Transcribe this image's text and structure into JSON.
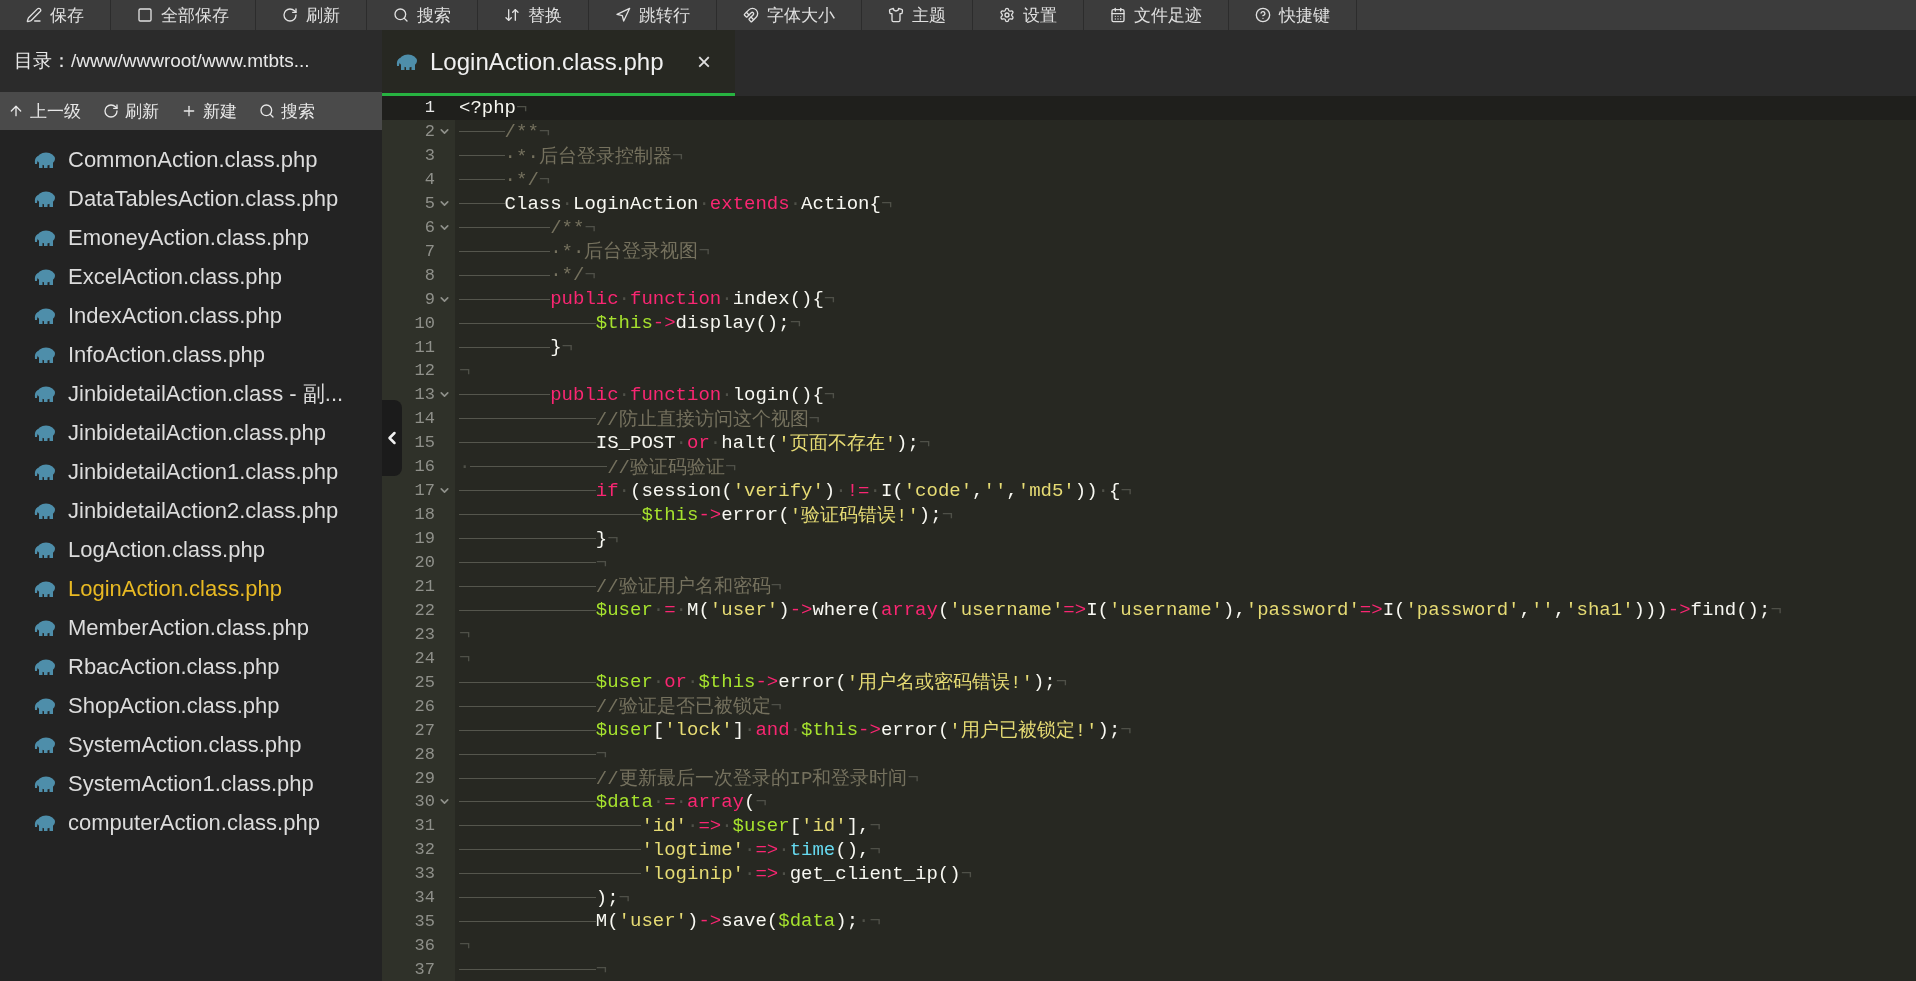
{
  "toolbar": [
    {
      "label": "保存"
    },
    {
      "label": "全部保存"
    },
    {
      "label": "刷新"
    },
    {
      "label": "搜索"
    },
    {
      "label": "替换"
    },
    {
      "label": "跳转行"
    },
    {
      "label": "字体大小"
    },
    {
      "label": "主题"
    },
    {
      "label": "设置"
    },
    {
      "label": "文件足迹"
    },
    {
      "label": "快捷键"
    }
  ],
  "sidebar": {
    "directory": "目录：/www/wwwroot/www.mtbts...",
    "actions": [
      {
        "label": "上一级"
      },
      {
        "label": "刷新"
      },
      {
        "label": "新建"
      },
      {
        "label": "搜索"
      }
    ],
    "files": [
      {
        "name": "CommonAction.class.php",
        "selected": false
      },
      {
        "name": "DataTablesAction.class.php",
        "selected": false
      },
      {
        "name": "EmoneyAction.class.php",
        "selected": false
      },
      {
        "name": "ExcelAction.class.php",
        "selected": false
      },
      {
        "name": "IndexAction.class.php",
        "selected": false
      },
      {
        "name": "InfoAction.class.php",
        "selected": false
      },
      {
        "name": "JinbidetailAction.class - 副...",
        "selected": false
      },
      {
        "name": "JinbidetailAction.class.php",
        "selected": false
      },
      {
        "name": "JinbidetailAction1.class.php",
        "selected": false
      },
      {
        "name": "JinbidetailAction2.class.php",
        "selected": false
      },
      {
        "name": "LogAction.class.php",
        "selected": false
      },
      {
        "name": "LoginAction.class.php",
        "selected": true
      },
      {
        "name": "MemberAction.class.php",
        "selected": false
      },
      {
        "name": "RbacAction.class.php",
        "selected": false
      },
      {
        "name": "ShopAction.class.php",
        "selected": false
      },
      {
        "name": "SystemAction.class.php",
        "selected": false
      },
      {
        "name": "SystemAction1.class.php",
        "selected": false
      },
      {
        "name": "computerAction.class.php",
        "selected": false
      }
    ]
  },
  "tabs": [
    {
      "label": "LoginAction.class.php",
      "close": "×",
      "selected": true
    }
  ],
  "code_lines": [
    {
      "number": "1",
      "active": true,
      "fold": false,
      "tokens": [
        {
          "kind": "pl",
          "text": "<?php"
        },
        {
          "kind": "ws",
          "text": "¬"
        }
      ]
    },
    {
      "number": "2",
      "active": false,
      "fold": true,
      "tokens": [
        {
          "kind": "tab"
        },
        {
          "kind": "cm",
          "text": "/**"
        },
        {
          "kind": "ws",
          "text": "¬"
        }
      ]
    },
    {
      "number": "3",
      "active": false,
      "fold": false,
      "tokens": [
        {
          "kind": "tab"
        },
        {
          "kind": "cm",
          "text": "·*·后台登录控制器"
        },
        {
          "kind": "ws",
          "text": "¬"
        }
      ]
    },
    {
      "number": "4",
      "active": false,
      "fold": false,
      "tokens": [
        {
          "kind": "tab"
        },
        {
          "kind": "cm",
          "text": "·*/"
        },
        {
          "kind": "ws",
          "text": "¬"
        }
      ]
    },
    {
      "number": "5",
      "active": false,
      "fold": true,
      "tokens": [
        {
          "kind": "tab"
        },
        {
          "kind": "pl",
          "text": "Class"
        },
        {
          "kind": "ws",
          "text": "·"
        },
        {
          "kind": "pl",
          "text": "LoginAction"
        },
        {
          "kind": "ws",
          "text": "·"
        },
        {
          "kind": "kw",
          "text": "extends"
        },
        {
          "kind": "ws",
          "text": "·"
        },
        {
          "kind": "pl",
          "text": "Action{"
        },
        {
          "kind": "ws",
          "text": "¬"
        }
      ]
    },
    {
      "number": "6",
      "active": false,
      "fold": true,
      "tokens": [
        {
          "kind": "tab"
        },
        {
          "kind": "tab"
        },
        {
          "kind": "cm",
          "text": "/**"
        },
        {
          "kind": "ws",
          "text": "¬"
        }
      ]
    },
    {
      "number": "7",
      "active": false,
      "fold": false,
      "tokens": [
        {
          "kind": "tab"
        },
        {
          "kind": "tab"
        },
        {
          "kind": "cm",
          "text": "·*·后台登录视图"
        },
        {
          "kind": "ws",
          "text": "¬"
        }
      ]
    },
    {
      "number": "8",
      "active": false,
      "fold": false,
      "tokens": [
        {
          "kind": "tab"
        },
        {
          "kind": "tab"
        },
        {
          "kind": "cm",
          "text": "·*/"
        },
        {
          "kind": "ws",
          "text": "¬"
        }
      ]
    },
    {
      "number": "9",
      "active": false,
      "fold": true,
      "tokens": [
        {
          "kind": "tab"
        },
        {
          "kind": "tab"
        },
        {
          "kind": "kw",
          "text": "public"
        },
        {
          "kind": "ws",
          "text": "·"
        },
        {
          "kind": "kw",
          "text": "function"
        },
        {
          "kind": "ws",
          "text": "·"
        },
        {
          "kind": "pl",
          "text": "index(){"
        },
        {
          "kind": "ws",
          "text": "¬"
        }
      ]
    },
    {
      "number": "10",
      "active": false,
      "fold": false,
      "tokens": [
        {
          "kind": "tab"
        },
        {
          "kind": "tab"
        },
        {
          "kind": "tab"
        },
        {
          "kind": "var",
          "text": "$this"
        },
        {
          "kind": "kw",
          "text": "->"
        },
        {
          "kind": "pl",
          "text": "display();"
        },
        {
          "kind": "ws",
          "text": "¬"
        }
      ]
    },
    {
      "number": "11",
      "active": false,
      "fold": false,
      "tokens": [
        {
          "kind": "tab"
        },
        {
          "kind": "tab"
        },
        {
          "kind": "pl",
          "text": "}"
        },
        {
          "kind": "ws",
          "text": "¬"
        }
      ]
    },
    {
      "number": "12",
      "active": false,
      "fold": false,
      "tokens": [
        {
          "kind": "ws",
          "text": "¬"
        }
      ]
    },
    {
      "number": "13",
      "active": false,
      "fold": true,
      "tokens": [
        {
          "kind": "tab"
        },
        {
          "kind": "tab"
        },
        {
          "kind": "kw",
          "text": "public"
        },
        {
          "kind": "ws",
          "text": "·"
        },
        {
          "kind": "kw",
          "text": "function"
        },
        {
          "kind": "ws",
          "text": "·"
        },
        {
          "kind": "pl",
          "text": "login(){"
        },
        {
          "kind": "ws",
          "text": "¬"
        }
      ]
    },
    {
      "number": "14",
      "active": false,
      "fold": false,
      "tokens": [
        {
          "kind": "tab"
        },
        {
          "kind": "tab"
        },
        {
          "kind": "tab"
        },
        {
          "kind": "cm",
          "text": "//防止直接访问这个视图"
        },
        {
          "kind": "ws",
          "text": "¬"
        }
      ]
    },
    {
      "number": "15",
      "active": false,
      "fold": false,
      "tokens": [
        {
          "kind": "tab"
        },
        {
          "kind": "tab"
        },
        {
          "kind": "tab"
        },
        {
          "kind": "pl",
          "text": "IS_POST"
        },
        {
          "kind": "ws",
          "text": "·"
        },
        {
          "kind": "kw",
          "text": "or"
        },
        {
          "kind": "ws",
          "text": "·"
        },
        {
          "kind": "pl",
          "text": "halt("
        },
        {
          "kind": "st",
          "text": "'页面不存在'"
        },
        {
          "kind": "pl",
          "text": ");"
        },
        {
          "kind": "ws",
          "text": "¬"
        }
      ]
    },
    {
      "number": "16",
      "active": false,
      "fold": false,
      "tokens": [
        {
          "kind": "ws",
          "text": "·"
        },
        {
          "kind": "tab"
        },
        {
          "kind": "tab"
        },
        {
          "kind": "tab"
        },
        {
          "kind": "cm",
          "text": "//验证码验证"
        },
        {
          "kind": "ws",
          "text": "¬"
        }
      ]
    },
    {
      "number": "17",
      "active": false,
      "fold": true,
      "tokens": [
        {
          "kind": "tab"
        },
        {
          "kind": "tab"
        },
        {
          "kind": "tab"
        },
        {
          "kind": "kw",
          "text": "if"
        },
        {
          "kind": "ws",
          "text": "·"
        },
        {
          "kind": "pl",
          "text": "(session("
        },
        {
          "kind": "st",
          "text": "'verify'"
        },
        {
          "kind": "pl",
          "text": ")"
        },
        {
          "kind": "ws",
          "text": "·"
        },
        {
          "kind": "kw",
          "text": "!="
        },
        {
          "kind": "ws",
          "text": "·"
        },
        {
          "kind": "pl",
          "text": "I("
        },
        {
          "kind": "st",
          "text": "'code'"
        },
        {
          "kind": "pl",
          "text": ","
        },
        {
          "kind": "st",
          "text": "''"
        },
        {
          "kind": "pl",
          "text": ","
        },
        {
          "kind": "st",
          "text": "'md5'"
        },
        {
          "kind": "pl",
          "text": "))"
        },
        {
          "kind": "ws",
          "text": "·"
        },
        {
          "kind": "pl",
          "text": "{"
        },
        {
          "kind": "ws",
          "text": "¬"
        }
      ]
    },
    {
      "number": "18",
      "active": false,
      "fold": false,
      "tokens": [
        {
          "kind": "tab"
        },
        {
          "kind": "tab"
        },
        {
          "kind": "tab"
        },
        {
          "kind": "tab"
        },
        {
          "kind": "var",
          "text": "$this"
        },
        {
          "kind": "kw",
          "text": "->"
        },
        {
          "kind": "pl",
          "text": "error("
        },
        {
          "kind": "st",
          "text": "'验证码错误!'"
        },
        {
          "kind": "pl",
          "text": ");"
        },
        {
          "kind": "ws",
          "text": "¬"
        }
      ]
    },
    {
      "number": "19",
      "active": false,
      "fold": false,
      "tokens": [
        {
          "kind": "tab"
        },
        {
          "kind": "tab"
        },
        {
          "kind": "tab"
        },
        {
          "kind": "pl",
          "text": "}"
        },
        {
          "kind": "ws",
          "text": "¬"
        }
      ]
    },
    {
      "number": "20",
      "active": false,
      "fold": false,
      "tokens": [
        {
          "kind": "tab"
        },
        {
          "kind": "tab"
        },
        {
          "kind": "tab"
        },
        {
          "kind": "ws",
          "text": "¬"
        }
      ]
    },
    {
      "number": "21",
      "active": false,
      "fold": false,
      "tokens": [
        {
          "kind": "tab"
        },
        {
          "kind": "tab"
        },
        {
          "kind": "tab"
        },
        {
          "kind": "cm",
          "text": "//验证用户名和密码"
        },
        {
          "kind": "ws",
          "text": "¬"
        }
      ]
    },
    {
      "number": "22",
      "active": false,
      "fold": false,
      "tokens": [
        {
          "kind": "tab"
        },
        {
          "kind": "tab"
        },
        {
          "kind": "tab"
        },
        {
          "kind": "var",
          "text": "$user"
        },
        {
          "kind": "ws",
          "text": "·"
        },
        {
          "kind": "kw",
          "text": "="
        },
        {
          "kind": "ws",
          "text": "·"
        },
        {
          "kind": "pl",
          "text": "M("
        },
        {
          "kind": "st",
          "text": "'user'"
        },
        {
          "kind": "pl",
          "text": ")"
        },
        {
          "kind": "kw",
          "text": "->"
        },
        {
          "kind": "pl",
          "text": "where("
        },
        {
          "kind": "kw",
          "text": "array"
        },
        {
          "kind": "pl",
          "text": "("
        },
        {
          "kind": "st",
          "text": "'username'"
        },
        {
          "kind": "kw",
          "text": "=>"
        },
        {
          "kind": "pl",
          "text": "I("
        },
        {
          "kind": "st",
          "text": "'username'"
        },
        {
          "kind": "pl",
          "text": "),"
        },
        {
          "kind": "st",
          "text": "'password'"
        },
        {
          "kind": "kw",
          "text": "=>"
        },
        {
          "kind": "pl",
          "text": "I("
        },
        {
          "kind": "st",
          "text": "'password'"
        },
        {
          "kind": "pl",
          "text": ","
        },
        {
          "kind": "st",
          "text": "''"
        },
        {
          "kind": "pl",
          "text": ","
        },
        {
          "kind": "st",
          "text": "'sha1'"
        },
        {
          "kind": "pl",
          "text": ")))"
        },
        {
          "kind": "kw",
          "text": "->"
        },
        {
          "kind": "pl",
          "text": "find();"
        },
        {
          "kind": "ws",
          "text": "¬"
        }
      ]
    },
    {
      "number": "23",
      "active": false,
      "fold": false,
      "tokens": [
        {
          "kind": "ws",
          "text": "¬"
        }
      ]
    },
    {
      "number": "24",
      "active": false,
      "fold": false,
      "tokens": [
        {
          "kind": "ws",
          "text": "¬"
        }
      ]
    },
    {
      "number": "25",
      "active": false,
      "fold": false,
      "tokens": [
        {
          "kind": "tab"
        },
        {
          "kind": "tab"
        },
        {
          "kind": "tab"
        },
        {
          "kind": "var",
          "text": "$user"
        },
        {
          "kind": "ws",
          "text": "·"
        },
        {
          "kind": "kw",
          "text": "or"
        },
        {
          "kind": "ws",
          "text": "·"
        },
        {
          "kind": "var",
          "text": "$this"
        },
        {
          "kind": "kw",
          "text": "->"
        },
        {
          "kind": "pl",
          "text": "error("
        },
        {
          "kind": "st",
          "text": "'用户名或密码错误!'"
        },
        {
          "kind": "pl",
          "text": ");"
        },
        {
          "kind": "ws",
          "text": "¬"
        }
      ]
    },
    {
      "number": "26",
      "active": false,
      "fold": false,
      "tokens": [
        {
          "kind": "tab"
        },
        {
          "kind": "tab"
        },
        {
          "kind": "tab"
        },
        {
          "kind": "cm",
          "text": "//验证是否已被锁定"
        },
        {
          "kind": "ws",
          "text": "¬"
        }
      ]
    },
    {
      "number": "27",
      "active": false,
      "fold": false,
      "tokens": [
        {
          "kind": "tab"
        },
        {
          "kind": "tab"
        },
        {
          "kind": "tab"
        },
        {
          "kind": "var",
          "text": "$user"
        },
        {
          "kind": "pl",
          "text": "["
        },
        {
          "kind": "st",
          "text": "'lock'"
        },
        {
          "kind": "pl",
          "text": "]"
        },
        {
          "kind": "ws",
          "text": "·"
        },
        {
          "kind": "kw",
          "text": "and"
        },
        {
          "kind": "ws",
          "text": "·"
        },
        {
          "kind": "var",
          "text": "$this"
        },
        {
          "kind": "kw",
          "text": "->"
        },
        {
          "kind": "pl",
          "text": "error("
        },
        {
          "kind": "st",
          "text": "'用户已被锁定!'"
        },
        {
          "kind": "pl",
          "text": ");"
        },
        {
          "kind": "ws",
          "text": "¬"
        }
      ]
    },
    {
      "number": "28",
      "active": false,
      "fold": false,
      "tokens": [
        {
          "kind": "tab"
        },
        {
          "kind": "tab"
        },
        {
          "kind": "tab"
        },
        {
          "kind": "ws",
          "text": "¬"
        }
      ]
    },
    {
      "number": "29",
      "active": false,
      "fold": false,
      "tokens": [
        {
          "kind": "tab"
        },
        {
          "kind": "tab"
        },
        {
          "kind": "tab"
        },
        {
          "kind": "cm",
          "text": "//更新最后一次登录的IP和登录时间"
        },
        {
          "kind": "ws",
          "text": "¬"
        }
      ]
    },
    {
      "number": "30",
      "active": false,
      "fold": true,
      "tokens": [
        {
          "kind": "tab"
        },
        {
          "kind": "tab"
        },
        {
          "kind": "tab"
        },
        {
          "kind": "var",
          "text": "$data"
        },
        {
          "kind": "ws",
          "text": "·"
        },
        {
          "kind": "kw",
          "text": "="
        },
        {
          "kind": "ws",
          "text": "·"
        },
        {
          "kind": "kw",
          "text": "array"
        },
        {
          "kind": "pl",
          "text": "("
        },
        {
          "kind": "ws",
          "text": "¬"
        }
      ]
    },
    {
      "number": "31",
      "active": false,
      "fold": false,
      "tokens": [
        {
          "kind": "tab"
        },
        {
          "kind": "tab"
        },
        {
          "kind": "tab"
        },
        {
          "kind": "tab"
        },
        {
          "kind": "st",
          "text": "'id'"
        },
        {
          "kind": "ws",
          "text": "·"
        },
        {
          "kind": "kw",
          "text": "=>"
        },
        {
          "kind": "ws",
          "text": "·"
        },
        {
          "kind": "var",
          "text": "$user"
        },
        {
          "kind": "pl",
          "text": "["
        },
        {
          "kind": "st",
          "text": "'id'"
        },
        {
          "kind": "pl",
          "text": "],"
        },
        {
          "kind": "ws",
          "text": "¬"
        }
      ]
    },
    {
      "number": "32",
      "active": false,
      "fold": false,
      "tokens": [
        {
          "kind": "tab"
        },
        {
          "kind": "tab"
        },
        {
          "kind": "tab"
        },
        {
          "kind": "tab"
        },
        {
          "kind": "st",
          "text": "'logtime'"
        },
        {
          "kind": "ws",
          "text": "·"
        },
        {
          "kind": "kw",
          "text": "=>"
        },
        {
          "kind": "ws",
          "text": "·"
        },
        {
          "kind": "bi",
          "text": "time"
        },
        {
          "kind": "pl",
          "text": "(),"
        },
        {
          "kind": "ws",
          "text": "¬"
        }
      ]
    },
    {
      "number": "33",
      "active": false,
      "fold": false,
      "tokens": [
        {
          "kind": "tab"
        },
        {
          "kind": "tab"
        },
        {
          "kind": "tab"
        },
        {
          "kind": "tab"
        },
        {
          "kind": "st",
          "text": "'loginip'"
        },
        {
          "kind": "ws",
          "text": "·"
        },
        {
          "kind": "kw",
          "text": "=>"
        },
        {
          "kind": "ws",
          "text": "·"
        },
        {
          "kind": "pl",
          "text": "get_client_ip()"
        },
        {
          "kind": "ws",
          "text": "¬"
        }
      ]
    },
    {
      "number": "34",
      "active": false,
      "fold": false,
      "tokens": [
        {
          "kind": "tab"
        },
        {
          "kind": "tab"
        },
        {
          "kind": "tab"
        },
        {
          "kind": "pl",
          "text": ");"
        },
        {
          "kind": "ws",
          "text": "¬"
        }
      ]
    },
    {
      "number": "35",
      "active": false,
      "fold": false,
      "tokens": [
        {
          "kind": "tab"
        },
        {
          "kind": "tab"
        },
        {
          "kind": "tab"
        },
        {
          "kind": "pl",
          "text": "M("
        },
        {
          "kind": "st",
          "text": "'user'"
        },
        {
          "kind": "pl",
          "text": ")"
        },
        {
          "kind": "kw",
          "text": "->"
        },
        {
          "kind": "pl",
          "text": "save("
        },
        {
          "kind": "var",
          "text": "$data"
        },
        {
          "kind": "pl",
          "text": ");"
        },
        {
          "kind": "ws",
          "text": "·¬"
        }
      ]
    },
    {
      "number": "36",
      "active": false,
      "fold": false,
      "tokens": [
        {
          "kind": "ws",
          "text": "¬"
        }
      ]
    },
    {
      "number": "37",
      "active": false,
      "fold": false,
      "tokens": [
        {
          "kind": "tab"
        },
        {
          "kind": "tab"
        },
        {
          "kind": "tab"
        },
        {
          "kind": "ws",
          "text": "¬"
        }
      ]
    }
  ]
}
